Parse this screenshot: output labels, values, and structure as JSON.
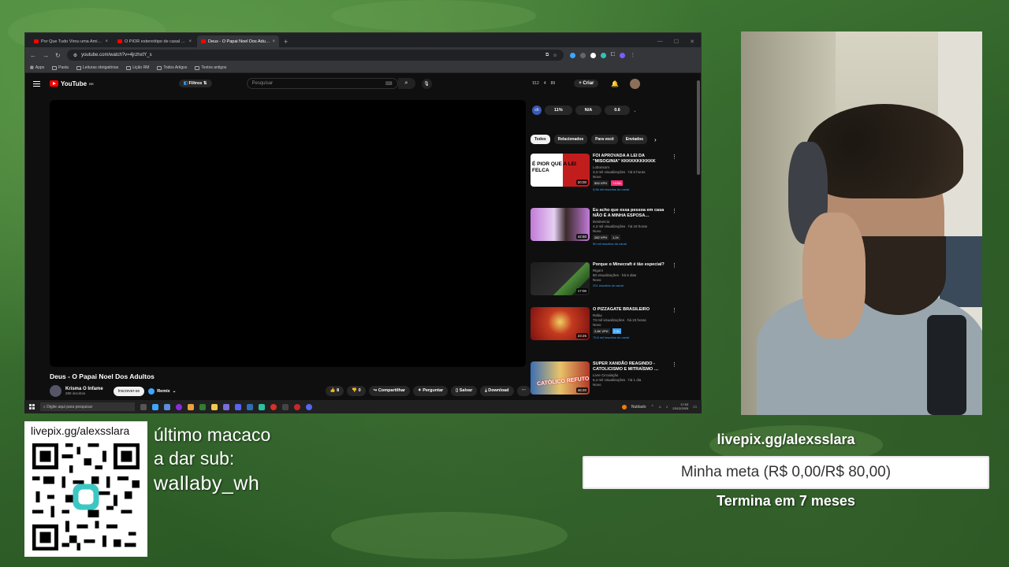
{
  "browser": {
    "tabs": [
      {
        "title": "Por Que Tudo Virou uma Amiz…"
      },
      {
        "title": "O PIOR estereótipo de casal o…"
      },
      {
        "title": "Deus - O Papai Noel Dos Adult…",
        "active": true
      }
    ],
    "new_tab": "+",
    "url": "youtube.com/watch?v=4jrzhxtY_s",
    "bookmarks": [
      "Apps",
      "Pasta",
      "Leituras obrigatórias",
      "Lição RM",
      "Todos Artigos",
      "Textos antigos"
    ]
  },
  "youtube": {
    "logo": "YouTube",
    "logo_suffix": "BR",
    "filters": "Filtros",
    "search_placeholder": "Pesquisar",
    "stats": [
      "512",
      "4",
      "89"
    ],
    "create": "Criar",
    "video_title": "Deus - O Papai Noel Dos Adultos",
    "channel": {
      "name": "Krisma O Infame",
      "subs": "280 inscritos"
    },
    "subscribe": "Inscrever-se",
    "remix": "Remix",
    "actions": {
      "like": "8",
      "dislike": "0",
      "share": "Compartilhar",
      "ask": "Perguntar",
      "save": "Salvar",
      "download": "Download"
    },
    "side_pills": [
      "11%",
      "N/A",
      "0.6"
    ],
    "chips": [
      "Todos",
      "Relacionados",
      "Para você",
      "Enviados"
    ],
    "recommendations": [
      {
        "title": "FOI APROVADA A LEI DA \"MISOGINIA\" KKKKKKKKKKK",
        "channel": "Lobonsom",
        "meta": "3,3 mil visualizações · há 6 horas",
        "badge": "Novo",
        "vph": "500 VPH",
        "extra": "+100x",
        "subs": "5,56 mil inscritos do canal",
        "duration": "20:00",
        "thumb_text": "É PIOR QUE A LEI FELCA"
      },
      {
        "title": "Eu acho que essa pessoa em casa NÃO É A MINHA ESPOSA…",
        "channel": "Desinercio",
        "meta": "4,3 mil visualizações · há 19 horas",
        "badge": "Novo",
        "vph": "282 VPH",
        "extra": "1,2x",
        "subs": "50 mil inscritos do canal",
        "duration": "42:50",
        "thumb_text": ""
      },
      {
        "title": "Porque o Minecraft é tão especial?",
        "channel": "Rigoni",
        "meta": "80 visualizações · há 6 dias",
        "badge": "Novo",
        "vph": "",
        "extra": "",
        "subs": "201 inscritos do canal",
        "duration": "17:00",
        "thumb_text": ""
      },
      {
        "title": "O PIZZAGATE BRASILEIRO",
        "channel": "Rafax",
        "meta": "73 mil visualizações · há 23 horas",
        "badge": "Novo",
        "vph": "2,6K VPH",
        "extra": "2,3x",
        "subs": "75,8 mil inscritos do canal",
        "duration": "23:25",
        "thumb_text": ""
      },
      {
        "title": "SUPER XANDÃO REAGINDO - CATOLICISMO E MITRAÍSMO …",
        "channel": "Livre Circulação",
        "meta": "6,4 mil visualizações · há 1 dia",
        "badge": "Novo",
        "vph": "",
        "extra": "",
        "subs": "",
        "duration": "46:20",
        "thumb_text": "CATÓLICO REFUTO"
      }
    ]
  },
  "taskbar": {
    "search_placeholder": "Digite aqui para pesquisar",
    "weather": "Nublado",
    "time": "17:03",
    "date": "23/12/2025"
  },
  "overlay": {
    "qr_url": "livepix.gg/alexsslara",
    "last_sub_line1": "último macaco",
    "last_sub_line2": "a dar sub:",
    "last_sub_name": "wallaby_wh",
    "goal_url": "livepix.gg/alexsslara",
    "goal_text": "Minha meta (R$ 0,00/R$ 80,00)",
    "goal_end": "Termina em 7 meses",
    "goal_progress": 0
  },
  "colors": {
    "youtube_red": "#ff0000",
    "bg_green": "#3f7335",
    "accent_blue": "#3ea6ff"
  }
}
